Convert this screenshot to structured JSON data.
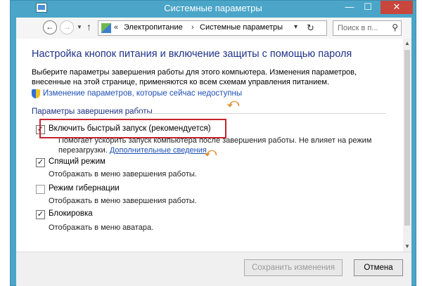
{
  "window": {
    "title": "Системные параметры"
  },
  "navbar": {
    "breadcrumb_root": "Электропитание",
    "breadcrumb_current": "Системные параметры",
    "search_placeholder": "Поиск в п..."
  },
  "content": {
    "heading": "Настройка кнопок питания и включение защиты с помощью пароля",
    "description": "Выберите параметры завершения работы для этого компьютера. Изменения параметров, внесенные на этой странице, применяются ко всем схемам управления питанием.",
    "admin_link": "Изменение параметров, которые сейчас недоступны",
    "section_label": "Параметры завершения работы",
    "options": [
      {
        "label": "Включить быстрый запуск (рекомендуется)",
        "checked": true,
        "desc_line1": "Помогает ускорить запуск компьютера после завершения работы. Не влияет на режим",
        "desc_line2": "перезагрузки.",
        "desc_link": "Дополнительные сведения"
      },
      {
        "label": "Спящий режим",
        "checked": true,
        "desc_line1": "Отображать в меню завершения работы."
      },
      {
        "label": "Режим гибернации",
        "checked": false,
        "desc_line1": "Отображать в меню завершения работы."
      },
      {
        "label": "Блокировка",
        "checked": true,
        "desc_line1": "Отображать в меню аватара."
      }
    ]
  },
  "footer": {
    "save_label": "Сохранить изменения",
    "cancel_label": "Отмена"
  },
  "colors": {
    "heading": "#1e3287",
    "link": "#1e4fb5",
    "highlight": "#c7242c",
    "arrow": "#e08a2a",
    "titlebar": "#4aa5c8",
    "close": "#c9463d"
  }
}
